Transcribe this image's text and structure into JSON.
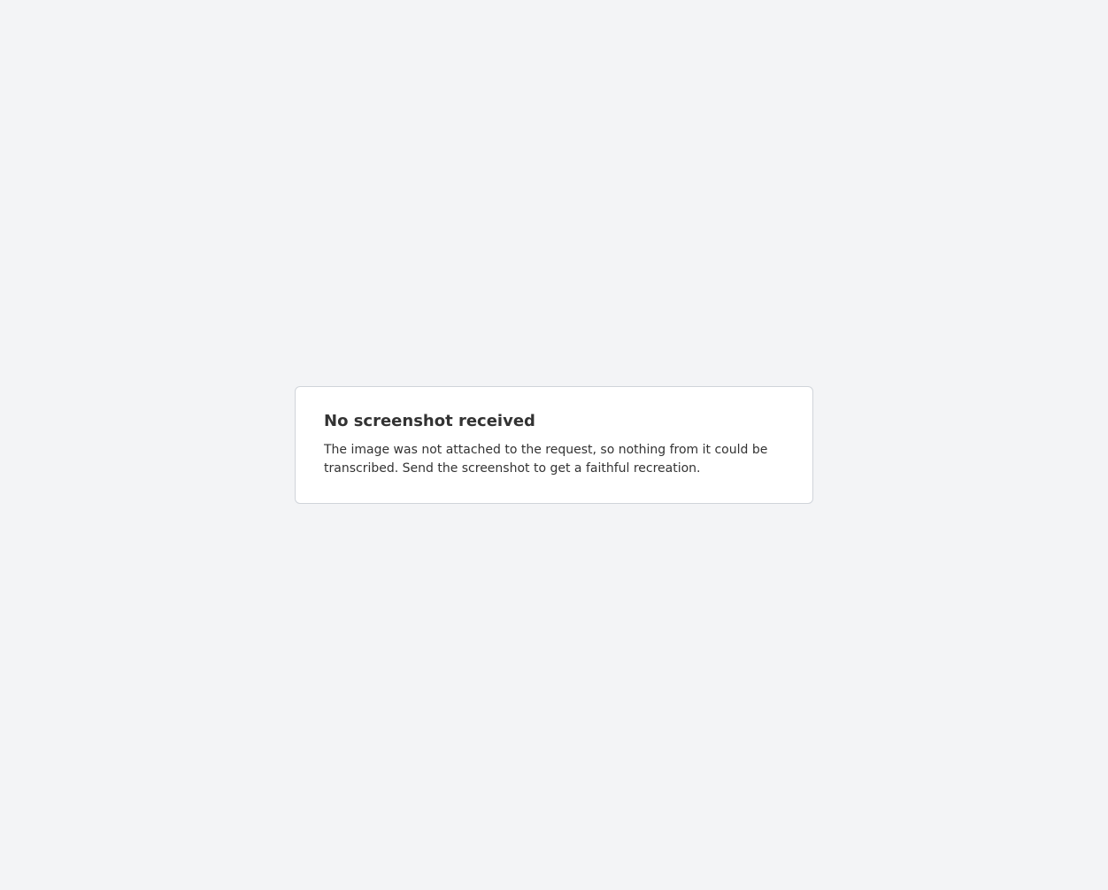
{
  "notice": {
    "title": "No screenshot received",
    "body": "The image was not attached to the request, so nothing from it could be transcribed. Send the screenshot to get a faithful recreation."
  }
}
